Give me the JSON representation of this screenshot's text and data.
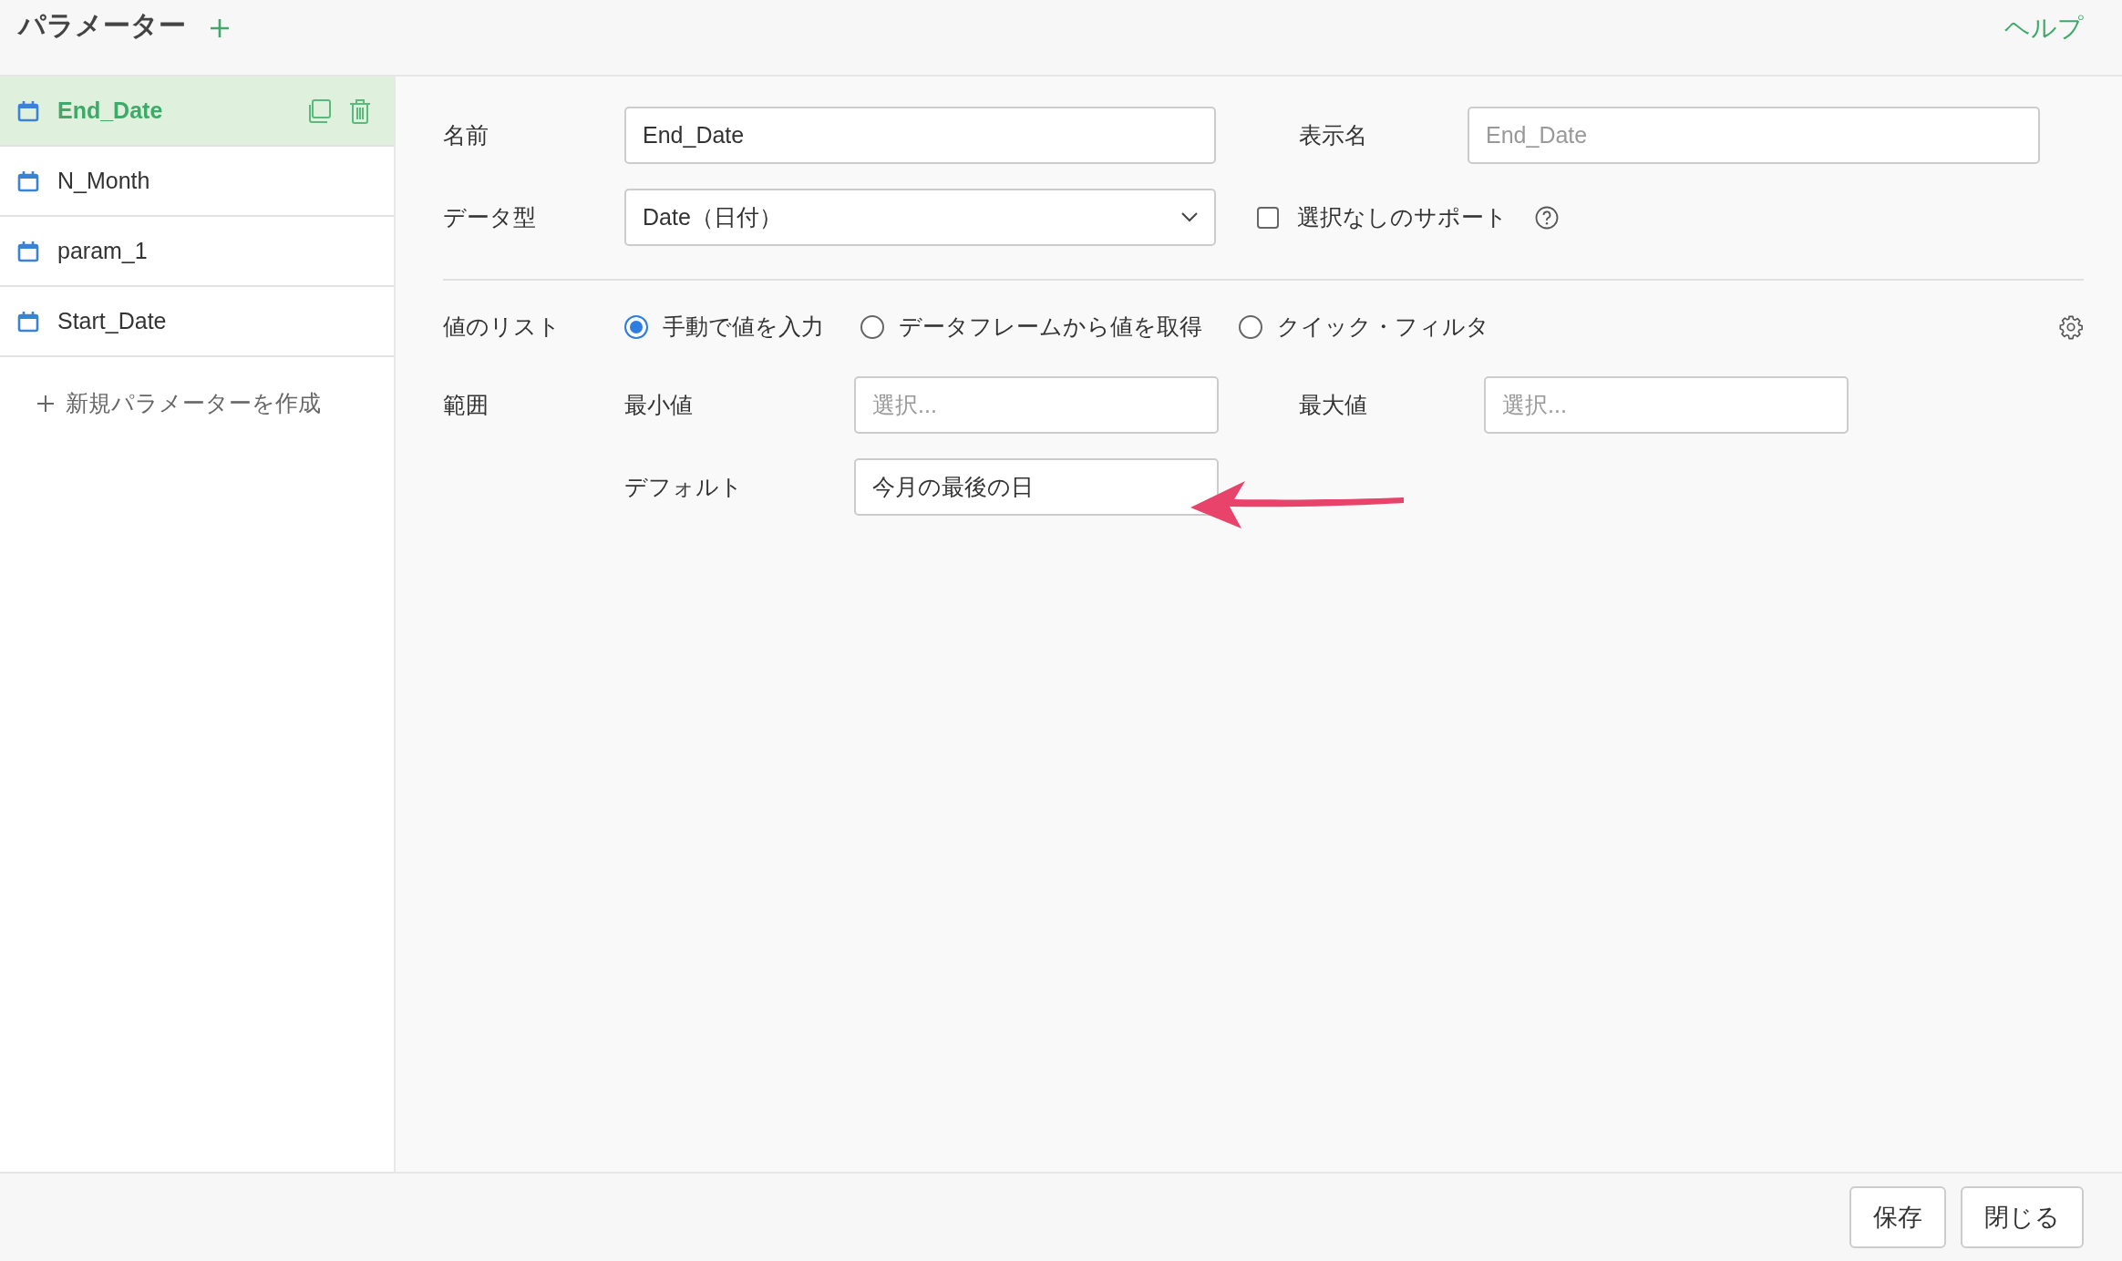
{
  "header": {
    "title": "パラメーター",
    "help_link": "ヘルプ"
  },
  "sidebar": {
    "items": [
      {
        "name": "End_Date",
        "selected": true
      },
      {
        "name": "N_Month",
        "selected": false
      },
      {
        "name": "param_1",
        "selected": false
      },
      {
        "name": "Start_Date",
        "selected": false
      }
    ],
    "create_link": "新規パラメーターを作成"
  },
  "form": {
    "name": {
      "label": "名前",
      "value": "End_Date"
    },
    "display_name": {
      "label": "表示名",
      "placeholder": "End_Date"
    },
    "data_type": {
      "label": "データ型",
      "value": "Date（日付）"
    },
    "support_none": {
      "label": "選択なしのサポート",
      "checked": false
    },
    "value_list": {
      "label": "値のリスト",
      "options": [
        {
          "label": "手動で値を入力",
          "selected": true
        },
        {
          "label": "データフレームから値を取得",
          "selected": false
        },
        {
          "label": "クイック・フィルタ",
          "selected": false
        }
      ]
    },
    "range": {
      "label": "範囲",
      "min": {
        "label": "最小値",
        "placeholder": "選択..."
      },
      "max": {
        "label": "最大値",
        "placeholder": "選択..."
      },
      "default": {
        "label": "デフォルト",
        "value": "今月の最後の日"
      }
    }
  },
  "footer": {
    "buttons": [
      "保存",
      "閉じる"
    ]
  }
}
